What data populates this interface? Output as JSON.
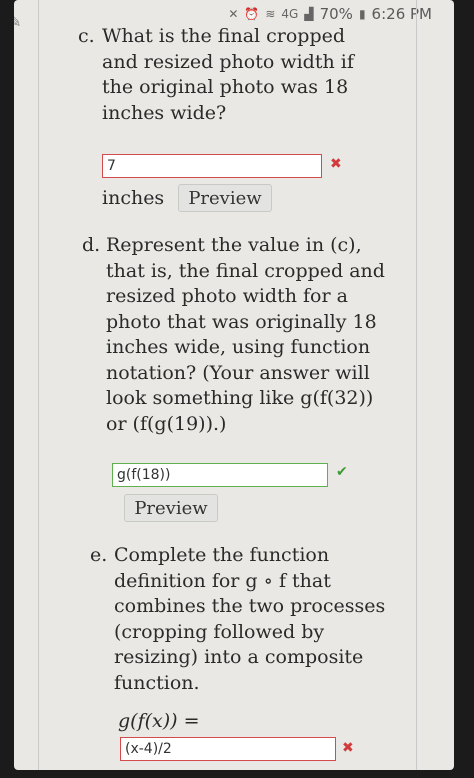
{
  "status_bar": {
    "icons": [
      "mute-icon",
      "alarm-icon",
      "wifi-icon",
      "4g-icon",
      "signal-icon"
    ],
    "network_label": "4G",
    "battery": "70%",
    "time": "6:26 PM"
  },
  "question_c": {
    "label": "c.",
    "text": "What is the final cropped\nand resized photo width if\nthe original photo was 18\ninches wide?",
    "answer_value": "7",
    "answer_status": "incorrect",
    "unit": "inches",
    "preview_label": "Preview"
  },
  "question_d": {
    "label": "d.",
    "text": "Represent the value in (c),\nthat is, the final cropped and\nresized photo width for a\nphoto that was originally 18\ninches wide, using function\nnotation? (Your answer will\nlook something like g(f(32))\nor (f(g(19)).)",
    "answer_value": "g(f(18))",
    "answer_status": "correct",
    "preview_label": "Preview"
  },
  "question_e": {
    "label": "e.",
    "text": "Complete the function\ndefinition for g ∘ f that\ncombines the two processes\n(cropping followed by\nresizing) into a composite\nfunction.",
    "math_label": "g(f(x)) =",
    "answer_value": "(x-4)/2",
    "answer_status": "incorrect"
  },
  "colors": {
    "correct": "#3e9a32",
    "incorrect": "#d23b3b",
    "page_bg": "#e9e8e4"
  }
}
